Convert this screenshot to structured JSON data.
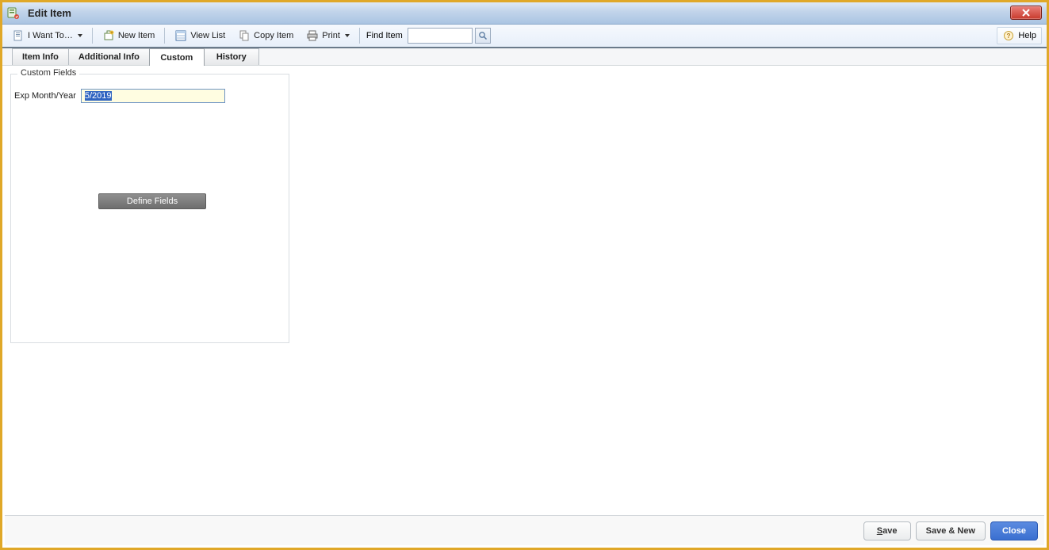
{
  "window": {
    "title": "Edit Item"
  },
  "toolbar": {
    "i_want_to": "I Want To…",
    "new_item": "New Item",
    "view_list": "View List",
    "copy_item": "Copy Item",
    "print": "Print",
    "find_item_label": "Find Item",
    "find_item_value": "",
    "help": "Help"
  },
  "tabs": [
    {
      "label": "Item Info",
      "active": false
    },
    {
      "label": "Additional Info",
      "active": false
    },
    {
      "label": "Custom",
      "active": true
    },
    {
      "label": "History",
      "active": false
    }
  ],
  "custom_panel": {
    "legend": "Custom Fields",
    "fields": [
      {
        "label": "Exp Month/Year",
        "value": "5/2019"
      }
    ],
    "define_fields_label": "Define Fields"
  },
  "footer": {
    "save": "Save",
    "save_new": "Save & New",
    "close": "Close"
  },
  "icons": {
    "app": "app-icon",
    "document": "document-icon",
    "new": "new-item-icon",
    "list": "list-icon",
    "copy": "copy-icon",
    "printer": "printer-icon",
    "search": "search-icon",
    "help": "help-icon",
    "close_window": "close-window-icon"
  }
}
